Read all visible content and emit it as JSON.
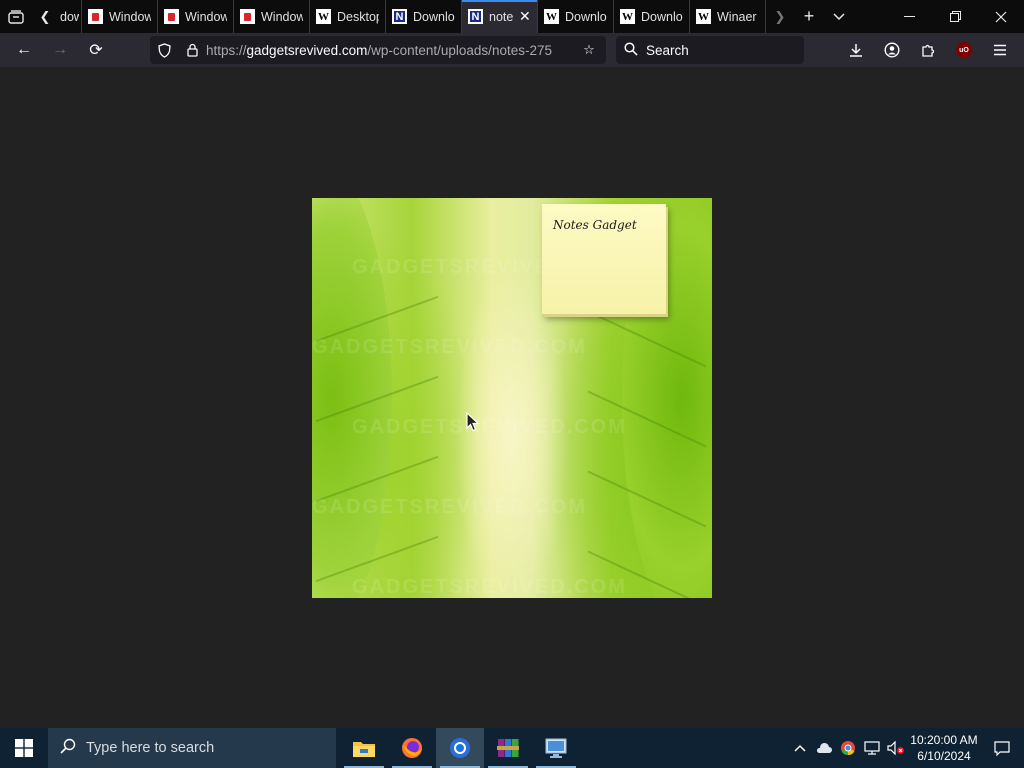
{
  "browser": {
    "tabs": [
      {
        "title": "dow",
        "favicon": "none"
      },
      {
        "title": "Windows",
        "favicon": "cards-icon"
      },
      {
        "title": "Windows",
        "favicon": "cards-icon"
      },
      {
        "title": "Windows",
        "favicon": "cards-icon"
      },
      {
        "title": "Desktop",
        "favicon": "w-icon"
      },
      {
        "title": "Downlo",
        "favicon": "n-icon"
      },
      {
        "title": "note",
        "favicon": "n-icon",
        "active": true
      },
      {
        "title": "Downlo",
        "favicon": "w-icon"
      },
      {
        "title": "Downlo",
        "favicon": "w-icon"
      },
      {
        "title": "Winaer",
        "favicon": "w-icon"
      }
    ],
    "url": {
      "prefix": "https://",
      "host": "gadgetsrevived.com",
      "path": "/wp-content/uploads/notes-275"
    },
    "search_placeholder": "Search",
    "accent": "#3b8beb"
  },
  "page": {
    "gadget_label": "Notes Gadget",
    "watermark": "GADGETSREVIVED.COM"
  },
  "taskbar": {
    "search_placeholder": "Type here to search",
    "time": "10:20:00 AM",
    "date": "6/10/2024",
    "pinned": [
      "file-explorer-icon",
      "firefox-icon",
      "chrome-icon",
      "winrar-icon",
      "remote-desktop-icon"
    ]
  }
}
